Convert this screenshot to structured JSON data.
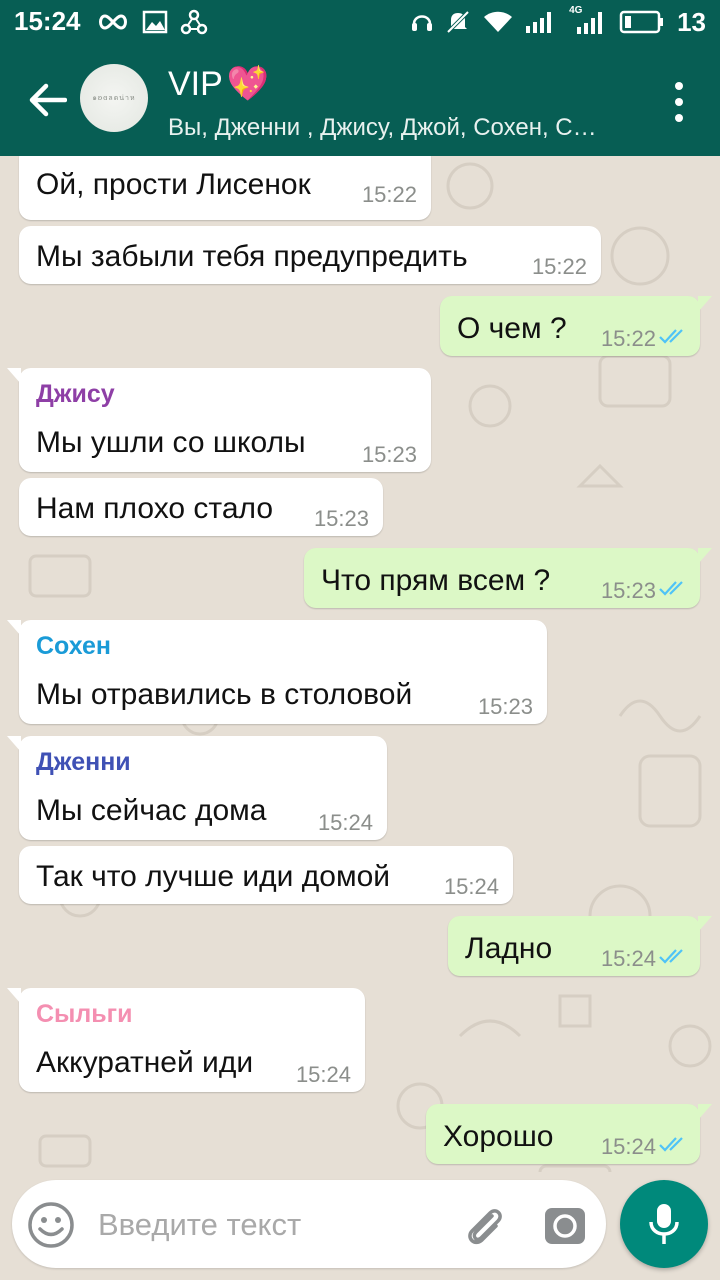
{
  "status_bar": {
    "time": "15:24",
    "battery_level": "13",
    "network_label": "4G",
    "icons": [
      "infinity-icon",
      "gallery-icon",
      "share-icon",
      "headset-icon",
      "mute-icon",
      "wifi-icon",
      "signal-icon",
      "signal-4g-icon",
      "battery-icon"
    ]
  },
  "header": {
    "title": "VIP",
    "title_emoji": "💖",
    "subtitle": "Вы, Дженни , Джису, Джой, Сохен, С…",
    "avatar_text": "๑ʚɞลดน่าห"
  },
  "colors": {
    "header": "#075e54",
    "incoming_bubble": "#ffffff",
    "outgoing_bubble": "#dcf8c6",
    "read_ticks": "#4fc3f7",
    "mic_button": "#00897b",
    "sender_jisoo": "#8e3fa6",
    "sender_sohen": "#1a9bd7",
    "sender_jennie": "#3f51b5",
    "sender_sylgi": "#f48fb1"
  },
  "messages": [
    {
      "dir": "in",
      "text": "Ой, прости Лисенок",
      "time": "15:22"
    },
    {
      "dir": "in",
      "text": "Мы забыли тебя предупредить",
      "time": "15:22"
    },
    {
      "dir": "out",
      "text": "О чем ?",
      "time": "15:22",
      "status": "read"
    },
    {
      "dir": "in",
      "sender": "Джису",
      "text": "Мы ушли со школы",
      "time": "15:23"
    },
    {
      "dir": "in",
      "text": "Нам плохо стало",
      "time": "15:23"
    },
    {
      "dir": "out",
      "text": "Что прям всем ?",
      "time": "15:23",
      "status": "read"
    },
    {
      "dir": "in",
      "sender": "Сохен",
      "text": "Мы отравились в столовой",
      "time": "15:23"
    },
    {
      "dir": "in",
      "sender": "Дженни",
      "text": "Мы сейчас дома",
      "time": "15:24"
    },
    {
      "dir": "in",
      "text": "Так что лучше иди домой",
      "time": "15:24"
    },
    {
      "dir": "out",
      "text": "Ладно",
      "time": "15:24",
      "status": "read"
    },
    {
      "dir": "in",
      "sender": "Сыльги",
      "text": "Аккуратней иди",
      "time": "15:24"
    },
    {
      "dir": "out",
      "text": "Хорошо",
      "time": "15:24",
      "status": "read"
    }
  ],
  "composer": {
    "placeholder": "Введите текст",
    "value": ""
  }
}
